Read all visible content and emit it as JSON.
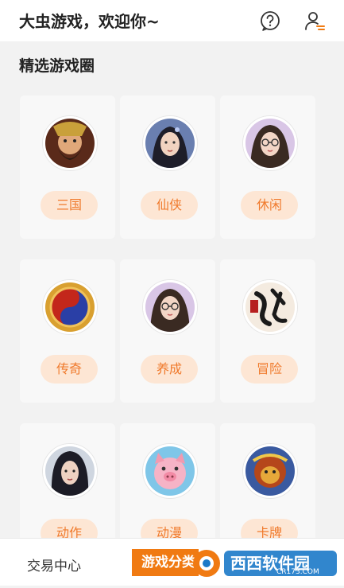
{
  "header": {
    "title": "大虫游戏，欢迎你~"
  },
  "section": {
    "title": "精选游戏圈"
  },
  "categories": [
    {
      "label": "三国",
      "avatar_icon": "warrior-general-icon",
      "palette": [
        "#8b2c1e",
        "#d7a54a"
      ]
    },
    {
      "label": "仙侠",
      "avatar_icon": "xianxia-lady-icon",
      "palette": [
        "#4a5b8a",
        "#e2c6b4"
      ]
    },
    {
      "label": "休闲",
      "avatar_icon": "glasses-girl-icon",
      "palette": [
        "#b9a3c9",
        "#f0d3c3"
      ]
    },
    {
      "label": "传奇",
      "avatar_icon": "red-blue-orb-icon",
      "palette": [
        "#c3271b",
        "#2a3fa6"
      ]
    },
    {
      "label": "养成",
      "avatar_icon": "glasses-girl-icon",
      "palette": [
        "#b9a3c9",
        "#f0d3c3"
      ]
    },
    {
      "label": "冒险",
      "avatar_icon": "calligraphy-logo-icon",
      "palette": [
        "#b61f1f",
        "#f4ebe0"
      ]
    },
    {
      "label": "动作",
      "avatar_icon": "swordswoman-icon",
      "palette": [
        "#2b2b3a",
        "#e6c8b8"
      ]
    },
    {
      "label": "动漫",
      "avatar_icon": "pink-pig-character-icon",
      "palette": [
        "#f19ab0",
        "#7fc6e8"
      ]
    },
    {
      "label": "卡牌",
      "avatar_icon": "monkey-king-icon",
      "palette": [
        "#b5471b",
        "#e6a83a"
      ]
    }
  ],
  "bottom_nav": {
    "trade": "交易中心",
    "games": "游戏分类"
  },
  "watermark": {
    "text": "西西软件园",
    "sub": "CR173.COM"
  },
  "colors": {
    "accent": "#f07a12",
    "tag_bg": "#fde6d4",
    "tag_text": "#f07a2c"
  }
}
